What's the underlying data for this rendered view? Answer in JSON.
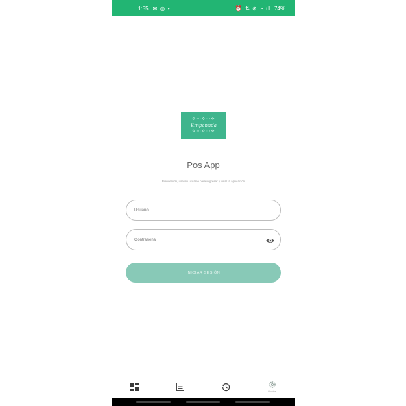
{
  "status_bar": {
    "time": "1:55",
    "left_icons": "✉ ◎ •",
    "right_icons": "⏰ ⇅ ⊛ ◔ ıl",
    "battery": "74%"
  },
  "logo": {
    "brand_text": "Empanada"
  },
  "app_title": "Pos App",
  "subtitle": "Bienvenido, use su usuario para ingresar y usar la aplicación",
  "username": {
    "placeholder": "Usuario",
    "value": ""
  },
  "password": {
    "placeholder": "Contraseña",
    "value": ""
  },
  "login_button": {
    "label": "Iniciar sesión"
  },
  "bottom_nav": {
    "items": [
      {
        "icon": "dashboard-icon",
        "label": ""
      },
      {
        "icon": "list-icon",
        "label": ""
      },
      {
        "icon": "history-icon",
        "label": ""
      },
      {
        "icon": "settings-icon",
        "label": "Ajustes"
      }
    ]
  },
  "colors": {
    "status_bar": "#22b573",
    "logo_bg": "#3fb58d",
    "button_bg": "#88c9b7"
  }
}
